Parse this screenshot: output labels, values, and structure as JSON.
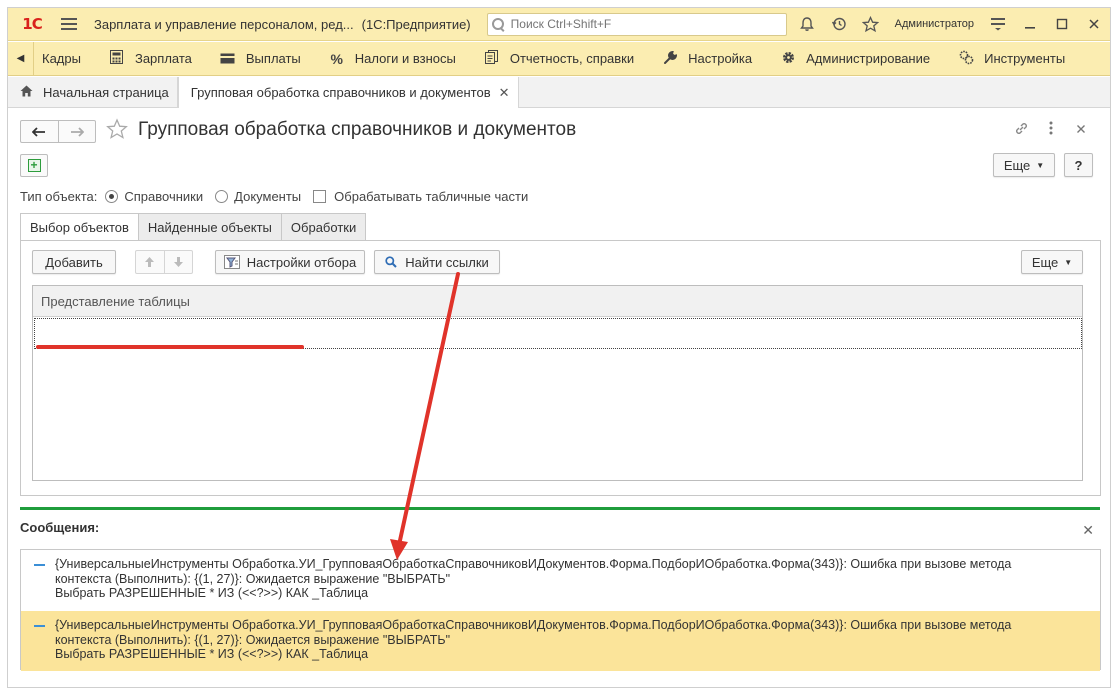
{
  "app": {
    "logo_text": "1С",
    "title": "Зарплата и управление персоналом, ред...",
    "platform": "(1С:Предприятие)",
    "search_placeholder": "Поиск Ctrl+Shift+F",
    "user": "Администратор"
  },
  "sections": [
    {
      "label": "Кадры",
      "icon": "left-arrow-icon"
    },
    {
      "label": "Зарплата",
      "icon": "calculator-icon"
    },
    {
      "label": "Выплаты",
      "icon": "wallet-icon"
    },
    {
      "label": "Налоги и взносы",
      "icon": "percent-icon"
    },
    {
      "label": "Отчетность, справки",
      "icon": "reports-icon"
    },
    {
      "label": "Настройка",
      "icon": "wrench-icon"
    },
    {
      "label": "Администрирование",
      "icon": "gear-icon"
    },
    {
      "label": "Инструменты",
      "icon": "tools-icon"
    }
  ],
  "open_tabs": {
    "home": "Начальная страница",
    "current": "Групповая обработка справочников и документов"
  },
  "form": {
    "title": "Групповая обработка справочников и документов",
    "more_label": "Еще",
    "help_label": "?",
    "object_type_label": "Тип объекта:",
    "radio_catalogs": "Справочники",
    "radio_documents": "Документы",
    "checkbox_tabular": "Обрабатывать табличные части"
  },
  "inner_tabs": [
    "Выбор объектов",
    "Найденные объекты",
    "Обработки"
  ],
  "toolbar": {
    "add_label": "Добавить",
    "filter_settings_label": "Настройки отбора",
    "find_links_label": "Найти ссылки",
    "more_label": "Еще"
  },
  "grid": {
    "column_header": "Представление таблицы"
  },
  "messages": {
    "title": "Сообщения:",
    "items": [
      {
        "line1": "{УниверсальныеИнструменты Обработка.УИ_ГрупповаяОбработкаСправочниковИДокументов.Форма.ПодборИОбработка.Форма(343)}: Ошибка при вызове метода",
        "line2": "контекста (Выполнить): {(1, 27)}: Ожидается выражение \"ВЫБРАТЬ\"",
        "line3": "Выбрать РАЗРЕШЕННЫЕ * ИЗ (<<?>>) КАК _Таблица"
      },
      {
        "line1": "{УниверсальныеИнструменты Обработка.УИ_ГрупповаяОбработкаСправочниковИДокументов.Форма.ПодборИОбработка.Форма(343)}: Ошибка при вызове метода",
        "line2": "контекста (Выполнить): {(1, 27)}: Ожидается выражение \"ВЫБРАТЬ\"",
        "line3": "Выбрать РАЗРЕШЕННЫЕ * ИЗ (<<?>>) КАК _Таблица"
      }
    ]
  },
  "colors": {
    "header_bg": "#fbedb1",
    "accent_green": "#1f9d3c",
    "annotation_red": "#e0332a",
    "selected_message_bg": "#fbe49a"
  }
}
